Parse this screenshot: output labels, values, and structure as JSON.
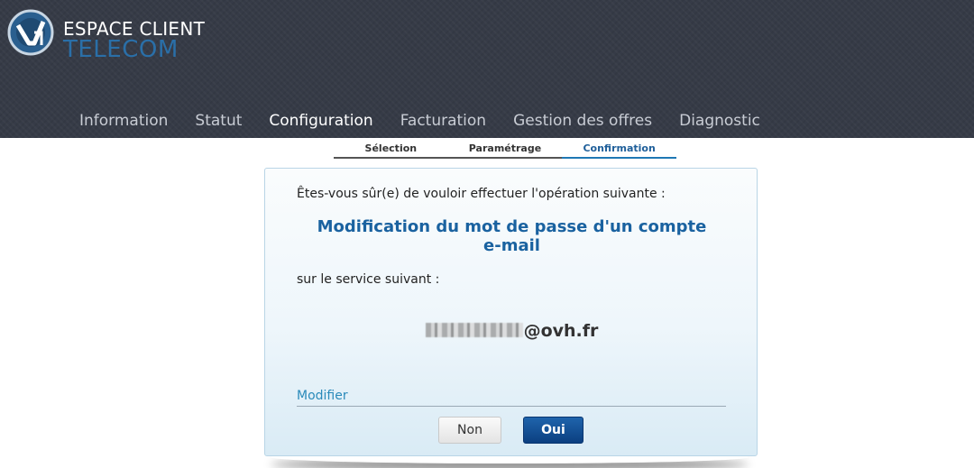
{
  "header": {
    "logo_line1": "ESPACE CLIENT",
    "logo_line2": "TELECOM",
    "colors": {
      "background": "#363b47",
      "accent": "#2a6fa8"
    }
  },
  "nav": {
    "items": [
      {
        "label": "Information"
      },
      {
        "label": "Statut"
      },
      {
        "label": "Configuration",
        "active": true
      },
      {
        "label": "Facturation"
      },
      {
        "label": "Gestion des offres"
      },
      {
        "label": "Diagnostic"
      }
    ]
  },
  "steps": {
    "items": [
      {
        "label": "Sélection"
      },
      {
        "label": "Paramétrage"
      },
      {
        "label": "Confirmation",
        "current": true
      }
    ]
  },
  "dialog": {
    "question": "Êtes-vous sûr(e) de vouloir effectuer l'opération suivante :",
    "operation": "Modification du mot de passe d'un compte e-mail",
    "service_label": "sur le service suivant :",
    "email_domain": "@ovh.fr",
    "modify_link": "Modifier",
    "no_button": "Non",
    "yes_button": "Oui"
  }
}
